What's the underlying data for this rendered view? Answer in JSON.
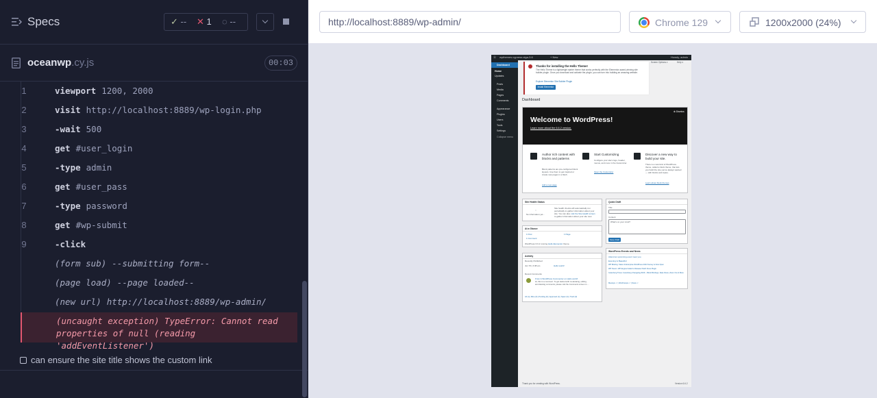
{
  "reporter": {
    "specs_label": "Specs",
    "stats": {
      "passed": "--",
      "failed": "1",
      "pending": "--"
    },
    "file": {
      "name": "oceanwp",
      "ext": ".cy.js",
      "duration": "00:03"
    },
    "commands": [
      {
        "num": "1",
        "name": "viewport",
        "msg": "1200, 2000"
      },
      {
        "num": "2",
        "name": "visit",
        "msg": "http://localhost:8889/wp-login.php"
      },
      {
        "num": "3",
        "name": "-wait",
        "msg": "500"
      },
      {
        "num": "4",
        "name": "get",
        "msg": "#user_login"
      },
      {
        "num": "5",
        "name": "-type",
        "msg": "admin"
      },
      {
        "num": "6",
        "name": "get",
        "msg": "#user_pass"
      },
      {
        "num": "7",
        "name": "-type",
        "msg": "password"
      },
      {
        "num": "8",
        "name": "get",
        "msg": "#wp-submit"
      },
      {
        "num": "9",
        "name": "-click",
        "msg": ""
      }
    ],
    "events": [
      {
        "name": "(form sub)",
        "msg": "--submitting form--"
      },
      {
        "name": "(page load)",
        "msg": "--page loaded--"
      },
      {
        "name": "(new url)",
        "msg": "http://localhost:8889/wp-admin/"
      }
    ],
    "error": {
      "line1": "(uncaught exception)  TypeError: Cannot read",
      "line2": "properties of null (reading 'addEventListener')"
    },
    "next_test": "can ensure the site title shows the custom link"
  },
  "aut": {
    "url": "http://localhost:8889/wp-admin/",
    "browser": "Chrome 129",
    "viewport": "1200x2000 (24%)"
  },
  "wp": {
    "adminbar": {
      "site": "wpthemes.cypress.oiga-3.6",
      "new": "+ New",
      "howdy": "Howdy, admin"
    },
    "sidebar": {
      "items": [
        "Dashboard",
        "Home",
        "Updates",
        "Posts",
        "Media",
        "Pages",
        "Comments",
        "Appearance",
        "Plugins",
        "Users",
        "Tools",
        "Settings",
        "Collapse menu"
      ]
    },
    "screen_options": "Screen Options ▾",
    "help": "Help ▾",
    "notice": {
      "title": "Thanks for installing the Hello Theme!",
      "text": "The Hello Theme is a lightweight starter theme that works perfectly with the Elementor award-winning site builder plugin. Once you download and activate the plugin, you can turn into building an amazing website.",
      "link": "Explore Elementor Site Builder Plugin",
      "button": "Install Elementor"
    },
    "dashboard_title": "Dashboard",
    "welcome": {
      "title": "Welcome to WordPress!",
      "subtitle": "Learn more about the 6.6.2 version.",
      "dismiss": "⊗ Dismiss",
      "columns": [
        {
          "title": "Author rich content with blocks and patterns",
          "text": "Block patterns are pre-configured block layouts. Use them to get inspired or create new pages in a flash.",
          "link": "Add a new page"
        },
        {
          "title": "Start Customizing",
          "text": "Configure your site's logo, header, menus, and more in the Customizer.",
          "link": "Open the Customizer"
        },
        {
          "title": "Discover a new way to build your site.",
          "text": "There is a new kind of WordPress theme, called a block theme, that lets you build the site you've always wanted — with blocks and styles.",
          "link": "Learn about block themes"
        }
      ]
    },
    "site_health": {
      "title": "Site Health Status",
      "status": "No information yet...",
      "text1": "Site health checks will automatically run",
      "text2": "periodically to gather information about your",
      "text3": "site. You can also",
      "link": "visit the Site Health screen",
      "text4": "to gather information about your site now."
    },
    "glance": {
      "title": "At a Glance",
      "posts": "1 Post",
      "pages": "1 Page",
      "comments": "1 Comment",
      "running": "WordPress 6.6.2 running",
      "theme": "Hello Elementor",
      "theme_suffix": "theme."
    },
    "activity": {
      "title": "Activity",
      "recent": "Recently Published",
      "date": "Jun 7th, 6:38 am",
      "post": "Hello world!",
      "comments_title": "Recent Comments",
      "comment_from": "From A WordPress Commenter on Hello world!",
      "comment_text1": "Hi, this is a comment. To get started with moderating, editing,",
      "comment_text2": "and deleting comments, please visit the Comments screen in ...",
      "filters": "All (1) | Mine (0) | Pending (0) | Approved (1) | Spam (0) | Trash (0)"
    },
    "quick_draft": {
      "title": "Quick Draft",
      "title_label": "Title",
      "content_label": "Content",
      "content_placeholder": "What's on your mind?",
      "button": "Save Draft"
    },
    "events": {
      "title": "WordPress Events and News",
      "items": [
        "Attend an upcoming event near you.",
        "Evening Is Beautiful",
        "WP Briefing: State of Enterprise WordPress 2024 Survey is Now Open",
        "WP Tavern: WP Engine Failed to Release Patch Fixes Plugin",
        "Gutenberg Times: Gutenberg Changelog #109 – Block Bindings, Data Views, Zoom Out & More",
        "Meetups ↗  |  WordCamps ↗  |  News ↗"
      ]
    },
    "footer": {
      "thanks": "Thank you for creating with WordPress.",
      "version": "Version 6.6.2"
    }
  },
  "colors": {
    "panel": "#1b1e2e",
    "error": "#e45770",
    "wp_blue": "#2271b1"
  }
}
